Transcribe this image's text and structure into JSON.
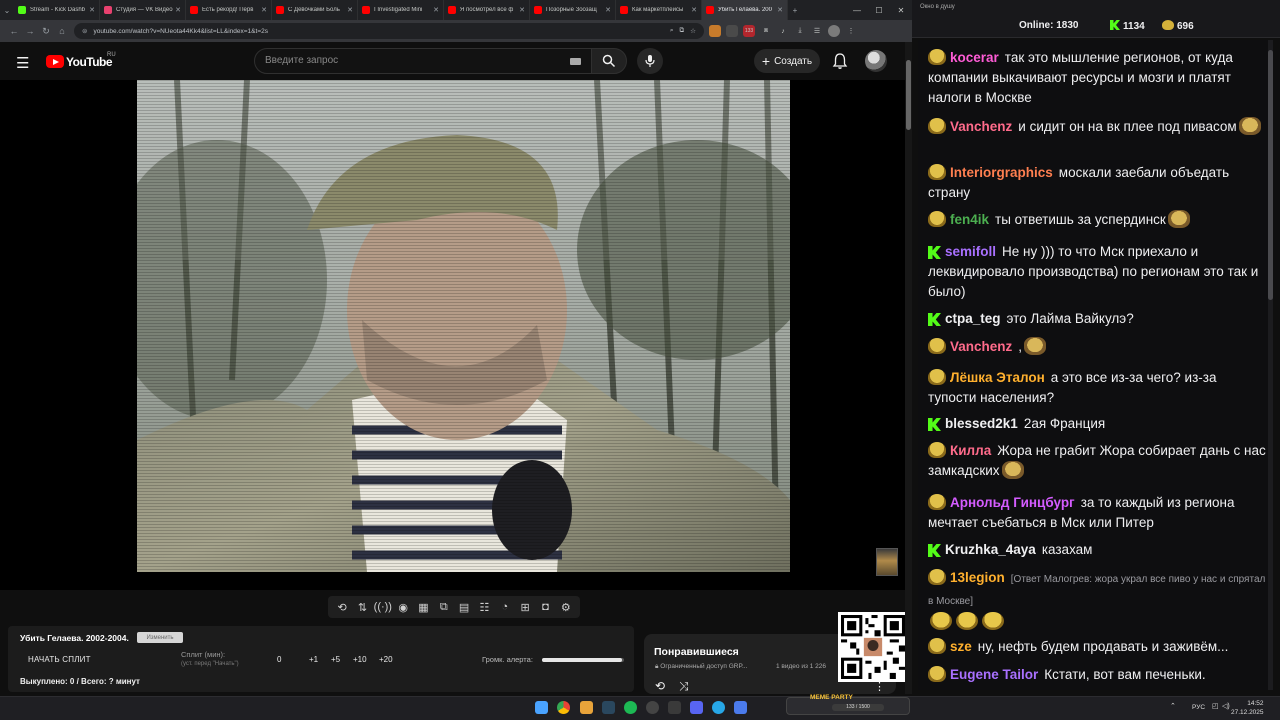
{
  "browser": {
    "tabs": [
      {
        "title": "Stream - Kick Dashb",
        "favicon": "kick-icon",
        "color": "#53fc18"
      },
      {
        "title": "Студия — VK Видео",
        "favicon": "vk-video-icon",
        "color": "#e8416f"
      },
      {
        "title": "Есть рекорд! Перв",
        "favicon": "youtube-icon",
        "color": "#ff0000"
      },
      {
        "title": "С Девочками Боль",
        "favicon": "youtube-icon",
        "color": "#ff0000"
      },
      {
        "title": "I Investigated Mini",
        "favicon": "youtube-icon",
        "color": "#ff0000"
      },
      {
        "title": "Я посмотрел все ф",
        "favicon": "youtube-icon",
        "color": "#ff0000"
      },
      {
        "title": "Позорные Зоозащ",
        "favicon": "youtube-icon",
        "color": "#ff0000"
      },
      {
        "title": "Как маркетплейсы",
        "favicon": "youtube-icon",
        "color": "#ff0000"
      },
      {
        "title": "Убить Гелаева. 200",
        "favicon": "youtube-icon",
        "color": "#ff0000",
        "active": true
      }
    ],
    "url": "youtube.com/watch?v=NUeota44Kk4&list=LL&index=1&t=2s"
  },
  "youtube": {
    "logo_text": "YouTube",
    "region": "RU",
    "search_placeholder": "Введите запрос",
    "create_label": "Создать"
  },
  "alerts": {
    "video_title": "Убить Гелаева. 2002-2004.",
    "edit_label": "Изменить",
    "start_split": "НАЧАТЬ СПЛИТ",
    "split_label": "Сплит (мин):",
    "split_hint": "(уст. перед \"Начать\")",
    "split_buttons": [
      "0",
      "+1",
      "+5",
      "+10",
      "+20"
    ],
    "volume_label": "Громк. алерта:",
    "volume_level": 0.97,
    "bought_line": "Выкуплено: 0 / Всего: ? минут"
  },
  "playlist": {
    "title": "Понравившиеся",
    "access": "Ограниченный доступ",
    "owner": "GRP...",
    "count": "1 видео из 1 226"
  },
  "chat": {
    "window_title": "Окно в душу",
    "online_label": "Online:",
    "online": "1830",
    "kick_count": "1134",
    "pepe_count": "696",
    "messages": [
      {
        "user": "kocerar",
        "color": "#ff5cd6",
        "badge": "pepe",
        "text": "так это мышление регионов, от куда компании выкачивают ресурсы и мозги и платят налоги в Москве"
      },
      {
        "user": "Vanchenz",
        "color": "#ff6b8b",
        "badge": "pepe",
        "text": "и сидит он на вк плее под пивасом",
        "emote": true
      },
      {
        "user": "Interiorgraphics",
        "color": "#ff7f50",
        "badge": "pepe",
        "text": "москали заебали объедать страну"
      },
      {
        "user": "fen4ik",
        "color": "#4caf50",
        "badge": "pepe",
        "text": "ты ответишь за успердинск",
        "emote": true
      },
      {
        "user": "semifoll",
        "color": "#a970ff",
        "badge": "kick",
        "text": "Не ну ))) то что Мск приехало и леквидировало производства) по регионам это так и было)"
      },
      {
        "user": "ctpa_teg",
        "color": "#efeff1",
        "badge": "kick",
        "text": "это Лайма Вайкулэ?"
      },
      {
        "user": "Vanchenz",
        "color": "#ff6b8b",
        "badge": "pepe",
        "text": ",",
        "emote": true
      },
      {
        "user": "Лёшка Эталон",
        "color": "#ffb02e",
        "badge": "pepe",
        "text": "а это все из-за чего? из-за тупости населения?"
      },
      {
        "user": "blessed2k1",
        "color": "#efeff1",
        "badge": "kick",
        "text": "2ая Франция"
      },
      {
        "user": "Килла",
        "color": "#ff6b8b",
        "badge": "pepe",
        "text": "Жора не грабит Жора собирает дань с нас замкадских",
        "emote": true
      },
      {
        "user": "Арнольд Гинцбург",
        "color": "#d45cff",
        "badge": "pepe",
        "text": "за то каждый из региона мечтает съебаться в Мск или Питер"
      },
      {
        "user": "Kruzhka_4aya",
        "color": "#efeff1",
        "badge": "kick",
        "text": "казахам"
      },
      {
        "user": "13legion",
        "color": "#ffb02e",
        "badge": "pepe",
        "reply": "[Ответ Малогрев: жора украл все пиво у нас и спрятал в Москве]",
        "text": ""
      },
      {
        "user": "sze",
        "color": "#ffb02e",
        "badge": "pepe",
        "text": "ну, нефть будем продавать и заживём..."
      },
      {
        "user": "Eugene Tailor",
        "color": "#a970ff",
        "badge": "pepe",
        "text": "Кстати, вот вам печеньки."
      }
    ]
  },
  "taskbar": {
    "memes_label": "MEME PARTY",
    "memes_progress": "133 / 1500",
    "lang": "РУС",
    "time": "14:52",
    "date": "27.12.2025"
  }
}
